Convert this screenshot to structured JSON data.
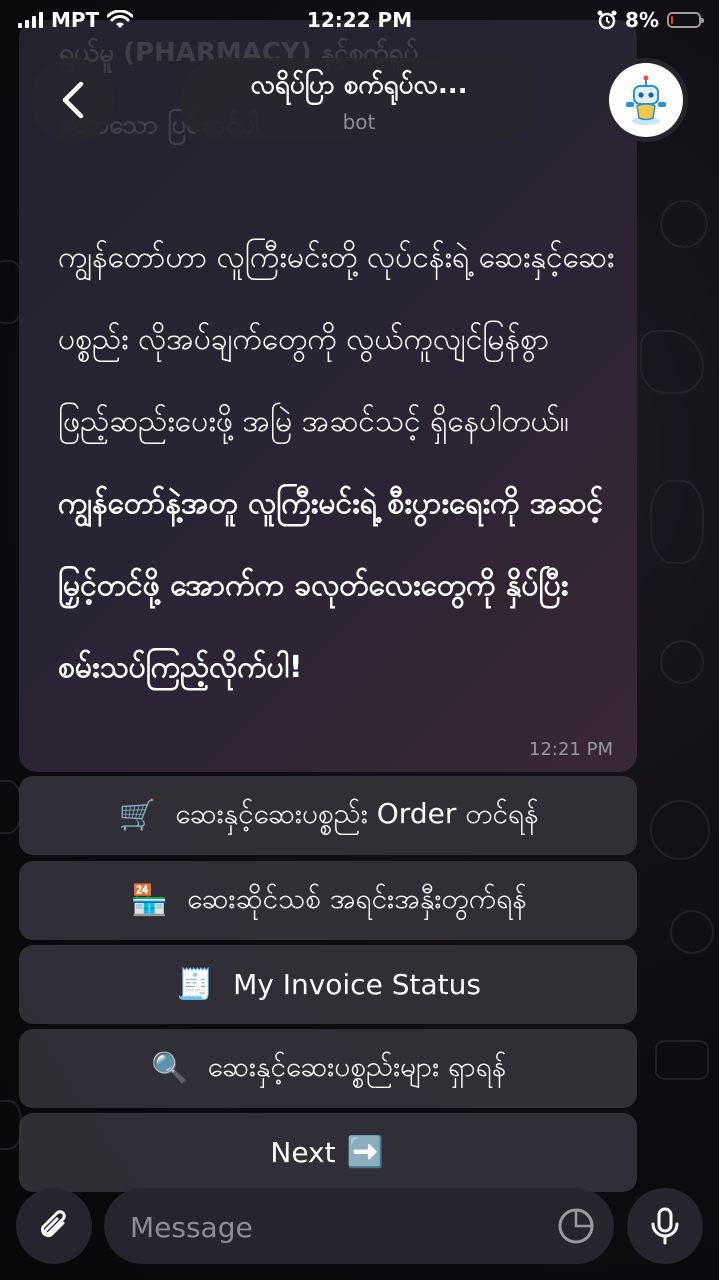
{
  "status_bar": {
    "carrier": "MPT",
    "time": "12:22 PM",
    "battery": "8%",
    "battery_level": 0.08,
    "battery_color": "#ff3b30"
  },
  "header": {
    "title": "လရိပ်ပြာ စက်ရုပ်လ...",
    "subtitle": "bot",
    "back_icon": "chevron-left-icon",
    "avatar_icon": "robot-icon"
  },
  "message": {
    "text_normal": "ကျွန်တော်ဟာ လူကြီးမင်းတို့ လုပ်ငန်းရဲ့ ဆေးနှင့်ဆေးပစ္စည်း လိုအပ်ချက်တွေကို လွယ်ကူလျင်မြန်စွာ ဖြည့်ဆည်းပေးဖို့ အမြဲ အဆင်သင့် ရှိနေပါတယ်။",
    "text_bold": "ကျွန်တော်နဲ့အတူ လူကြီးမင်းရဲ့ စီးပွားရေးကို အဆင့်မြှင့်တင်ဖို့ အောက်က ခလုတ်လေးတွေကို နှိပ်ပြီး စမ်းသပ်ကြည့်လိုက်ပါ!",
    "time": "12:21 PM",
    "ghost_line_1": "ရွယ်မှု (PHARMACY) နှင့်စက်ရုပ်",
    "ghost_line_2": "တောသော ပြင်ဆင်ပါ"
  },
  "keyboard": {
    "buttons": [
      {
        "emoji": "🛒",
        "label": "ဆေးနှင့်ဆေးပစ္စည်း Order တင်ရန်"
      },
      {
        "emoji": "🏪",
        "label": "ဆေးဆိုင်သစ် အရင်းအနှီးတွက်ရန်"
      },
      {
        "emoji": "🧾",
        "label": "My Invoice Status"
      },
      {
        "emoji": "🔍",
        "label": "ဆေးနှင့်ဆေးပစ္စည်းများ ရှာရန်"
      },
      {
        "emoji": "➡️",
        "label": "Next"
      }
    ]
  },
  "input_bar": {
    "placeholder": "Message",
    "attach_icon": "paperclip-icon",
    "sticker_icon": "sticker-icon",
    "mic_icon": "microphone-icon"
  },
  "colors": {
    "accent": "#ffffff",
    "bubble_start": "#23232e",
    "bubble_end": "#3a2735",
    "button_bg": "#34323a"
  }
}
